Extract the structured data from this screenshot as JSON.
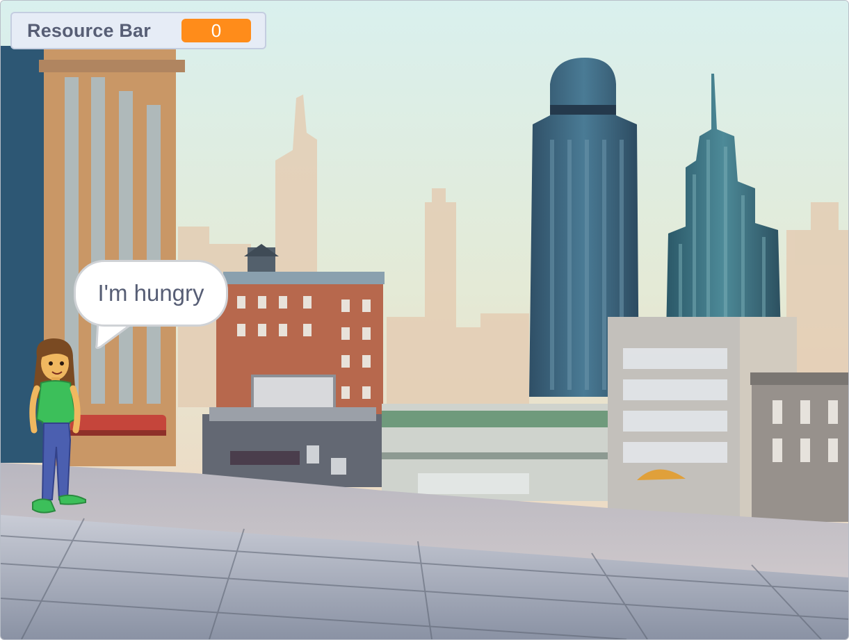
{
  "monitor": {
    "label": "Resource Bar",
    "value": "0",
    "value_color": "#ff8c1a"
  },
  "speech_bubble": {
    "text": "I'm hungry"
  },
  "sprite": {
    "name": "girl-character"
  },
  "backdrop": {
    "name": "city-rooftop"
  },
  "colors": {
    "monitor_bg": "#e6ecf6",
    "label_text": "#575e75",
    "sky": "#d6ecea"
  }
}
